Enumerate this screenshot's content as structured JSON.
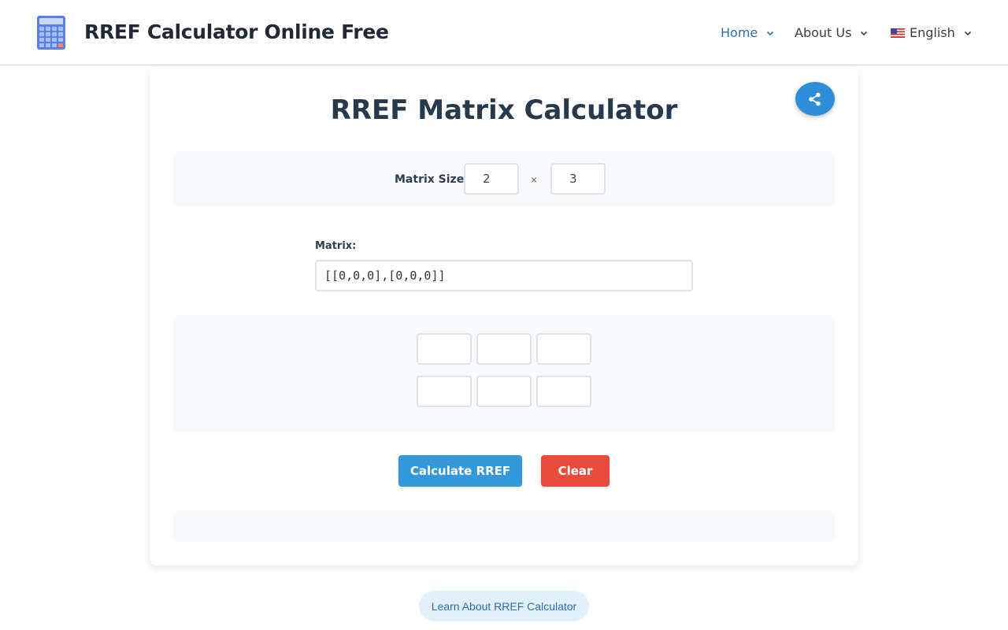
{
  "header": {
    "site_title": "RREF Calculator Online Free",
    "logo_icon": "calculator-icon",
    "nav": [
      {
        "label": "Home",
        "icon": "chevron-down-icon"
      },
      {
        "label": "About Us",
        "icon": "chevron-down-icon"
      },
      {
        "label": "English",
        "icon": "chevron-down-icon",
        "flag": "us-flag-icon"
      }
    ]
  },
  "calculator": {
    "title": "RREF Matrix Calculator",
    "share_icon": "share-icon",
    "size_label": "Matrix Size:",
    "rows": "2",
    "cols": "3",
    "times_symbol": "×",
    "matrix_label": "Matrix:",
    "matrix_value": "[[0,0,0],[0,0,0]]",
    "cells": [
      [
        "",
        "",
        ""
      ],
      [
        "",
        "",
        ""
      ]
    ],
    "calculate_label": "Calculate RREF",
    "clear_label": "Clear"
  },
  "footer": {
    "learn_label": "Learn About RREF Calculator"
  },
  "colors": {
    "primary": "#3498db",
    "danger": "#e74c3c",
    "nav_active": "#2e6fa8",
    "panel_bg": "#f8f9fa"
  }
}
